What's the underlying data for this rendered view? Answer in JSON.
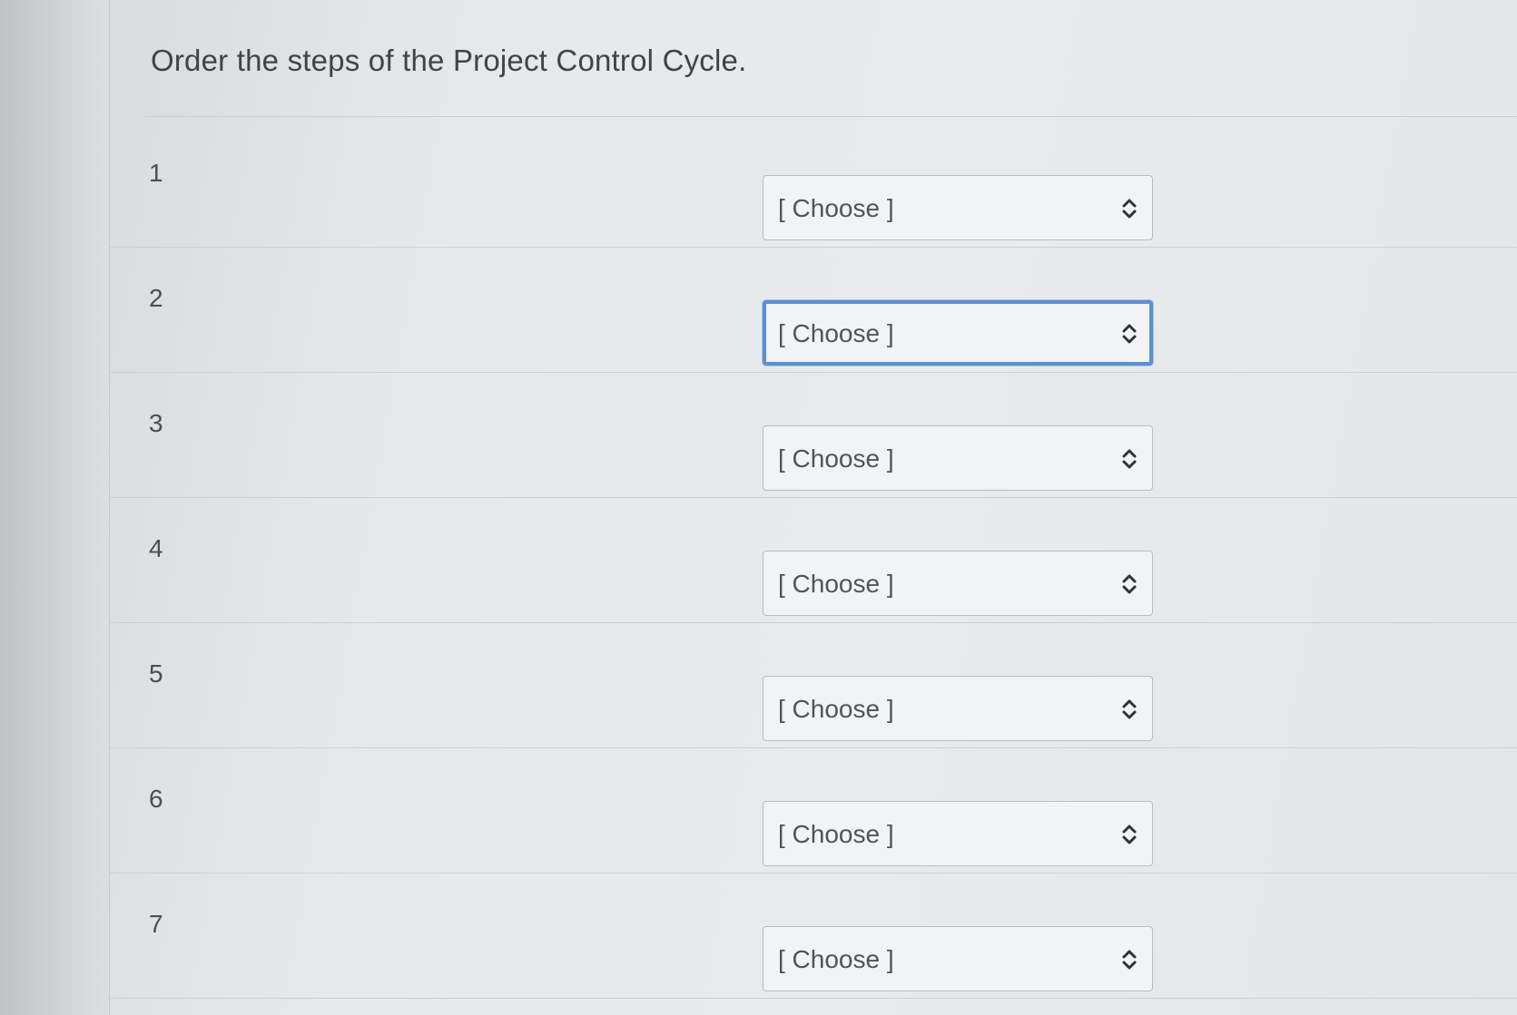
{
  "question": {
    "title": "Order the steps of the Project Control Cycle."
  },
  "rows": [
    {
      "number": "1",
      "selected": "[ Choose ]",
      "icon": "up-down-chevron-icon"
    },
    {
      "number": "2",
      "selected": "[ Choose ]",
      "icon": "up-down-chevron-icon",
      "focused": true
    },
    {
      "number": "3",
      "selected": "[ Choose ]",
      "icon": "up-down-chevron-icon"
    },
    {
      "number": "4",
      "selected": "[ Choose ]",
      "icon": "up-down-chevron-icon"
    },
    {
      "number": "5",
      "selected": "[ Choose ]",
      "icon": "up-down-chevron-icon"
    },
    {
      "number": "6",
      "selected": "[ Choose ]",
      "icon": "up-down-chevron-icon"
    },
    {
      "number": "7",
      "selected": "[ Choose ]",
      "icon": "up-down-chevron-icon"
    }
  ],
  "colors": {
    "focus_border": "#5d8fd1",
    "text": "#3f4447",
    "select_border": "#b9bdc0"
  }
}
